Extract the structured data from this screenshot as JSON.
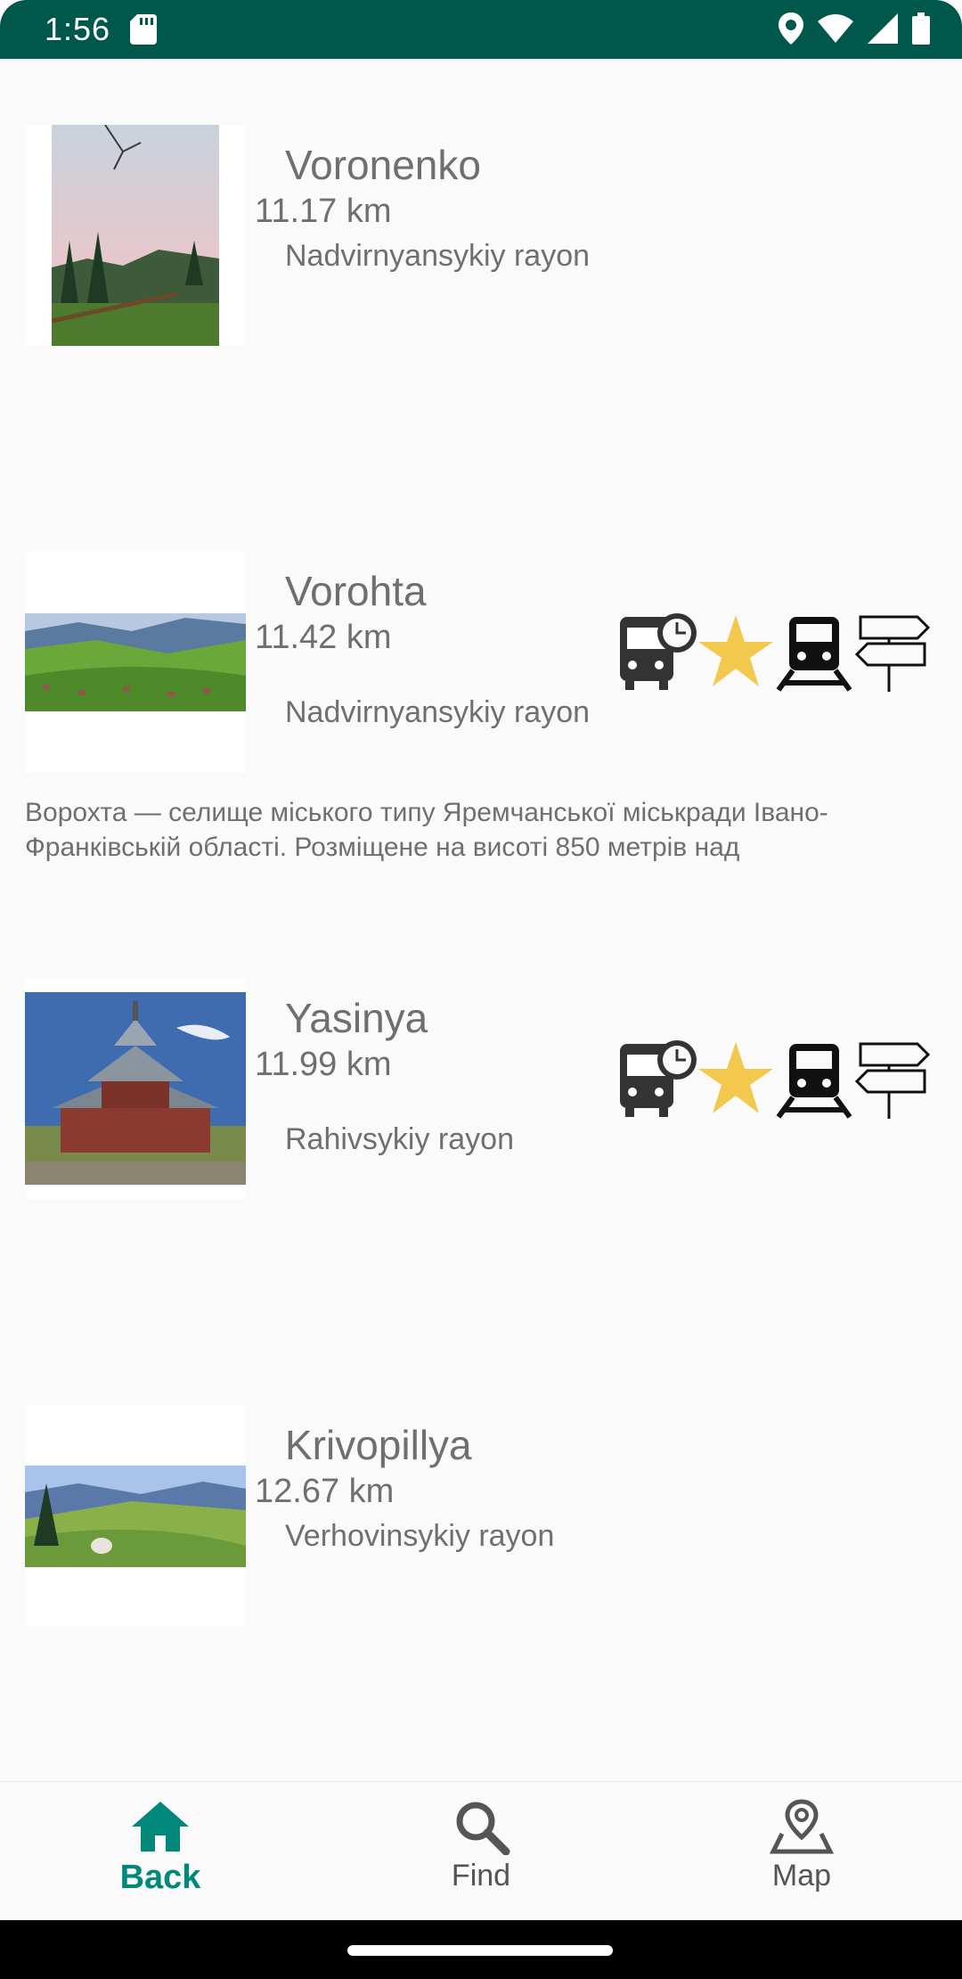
{
  "status_bar": {
    "time": "1:56",
    "icons": [
      "sd-card-icon",
      "location-icon",
      "wifi-icon",
      "signal-icon",
      "battery-icon"
    ]
  },
  "places": [
    {
      "name": "Voronenko",
      "distance": "11.17 km",
      "rayon": "Nadvirnyansykiy rayon",
      "description": "",
      "amenities": []
    },
    {
      "name": "Vorohta",
      "distance": "11.42 km",
      "rayon": "Nadvirnyansykiy rayon",
      "description": "Ворохта — селище міського типу Яремчанської міськради Івано-Франківській області. Розміщене на висоті 850 метрів над",
      "amenities": [
        "bus-schedule-icon",
        "star-icon",
        "train-icon",
        "signpost-icon"
      ]
    },
    {
      "name": "Yasinya",
      "distance": "11.99 km",
      "rayon": "Rahivsykiy rayon",
      "description": "",
      "amenities": [
        "bus-schedule-icon",
        "star-icon",
        "train-icon",
        "signpost-icon"
      ]
    },
    {
      "name": "Krivopillya",
      "distance": "12.67 km",
      "rayon": "Verhovinsykiy rayon",
      "description": "",
      "amenities": []
    }
  ],
  "bottom_nav": {
    "items": [
      {
        "label": "Back",
        "icon": "home-icon",
        "active": true
      },
      {
        "label": "Find",
        "icon": "search-icon",
        "active": false
      },
      {
        "label": "Map",
        "icon": "map-pin-icon",
        "active": false
      }
    ]
  },
  "colors": {
    "status_bar": "#00574b",
    "accent": "#00897b",
    "star": "#f2c94c",
    "text": "#6f6f6f"
  }
}
